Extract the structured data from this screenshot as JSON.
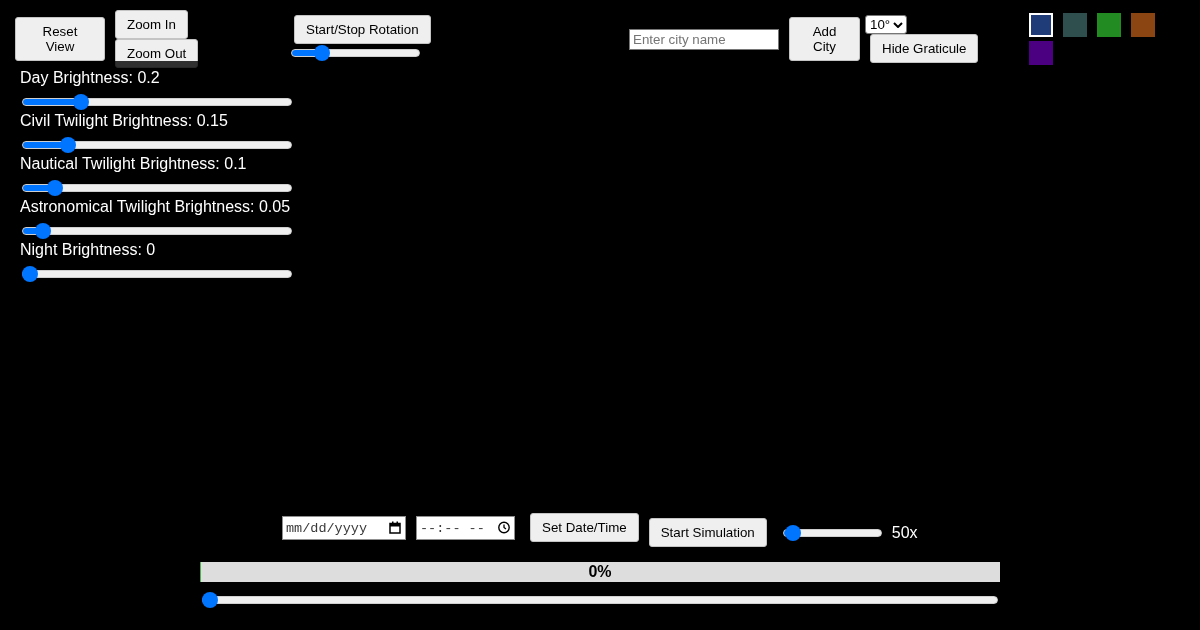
{
  "view_buttons": [
    {
      "label": "Reset View"
    },
    {
      "label": "Zoom In"
    },
    {
      "label": "Zoom Out"
    }
  ],
  "rotation": {
    "button": "Start/Stop Rotation",
    "speed": {
      "level": 0.2
    }
  },
  "city": {
    "input": {
      "placeholder": "Enter city name"
    },
    "button": "Add City"
  },
  "graticule": {
    "step": "10°",
    "button": "Hide Graticule"
  },
  "swatches": [
    {
      "color": "#1f3c78",
      "selected": true
    },
    {
      "color": "#2f4f4f",
      "selected": false
    },
    {
      "color": "#228b22",
      "selected": false
    },
    {
      "color": "#8b4513",
      "selected": false
    },
    {
      "color": "#4b0082",
      "selected": false
    }
  ],
  "brightness": [
    {
      "label": "Day Brightness: 0.2",
      "level": 0.2
    },
    {
      "label": "Civil Twilight Brightness: 0.15",
      "level": 0.15
    },
    {
      "label": "Nautical Twilight Brightness: 0.1",
      "level": 0.1
    },
    {
      "label": "Astronomical Twilight Brightness: 0.05",
      "level": 0.05
    },
    {
      "label": "Night Brightness: 0",
      "level": 0
    }
  ],
  "simulation": {
    "date": {
      "placeholder": "mm/dd/yyyy"
    },
    "time": {
      "placeholder": "--:-- --"
    },
    "set_button": "Set Date/Time",
    "start_button": "Start Simulation",
    "speed": {
      "level": 0.03,
      "reading": "50x"
    }
  },
  "progress": {
    "level": 0,
    "reading": "0%"
  },
  "timeline": {
    "level": 0
  }
}
